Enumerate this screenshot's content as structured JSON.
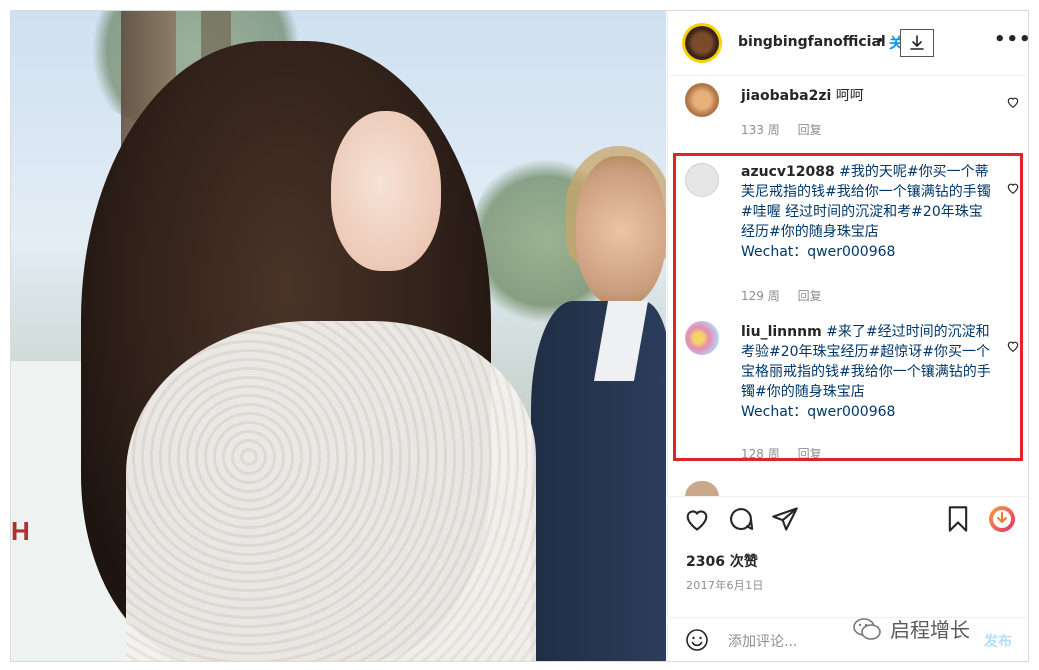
{
  "post": {
    "username": "bingbingfanofficial",
    "separator": "•",
    "follow_label": "关注",
    "more_label": "•••",
    "photo_sign_text": "H"
  },
  "comments": [
    {
      "user": "jiaobaba2zi",
      "text": "呵呵",
      "tags": "",
      "wechat": "",
      "age": "133 周",
      "reply_label": "回复"
    },
    {
      "user": "azucv12088",
      "text": "",
      "tags": "#我的天呢#你买一个蒂芙尼戒指的钱#我给你一个镶满钻的手镯#哇喔 经过时间的沉淀和考#20年珠宝经历#你的随身珠宝店",
      "wechat": "Wechat：qwer000968",
      "age": "129 周",
      "reply_label": "回复"
    },
    {
      "user": "liu_linnnm",
      "text": "",
      "tags": "#来了#经过时间的沉淀和考验#20年珠宝经历#超惊讶#你买一个宝格丽戒指的钱#我给你一个镶满钻的手镯#你的随身珠宝店",
      "wechat": "Wechat：qwer000968",
      "age": "128 周",
      "reply_label": "回复"
    }
  ],
  "footer": {
    "likes": "2306 次赞",
    "date": "2017年6月1日",
    "add_comment_placeholder": "添加评论...",
    "post_label": "发布"
  },
  "watermark": "启程增长",
  "colors": {
    "highlight": "#e0242a",
    "link": "#00376b",
    "follow": "#0095f6",
    "muted": "#8e8e8e"
  }
}
